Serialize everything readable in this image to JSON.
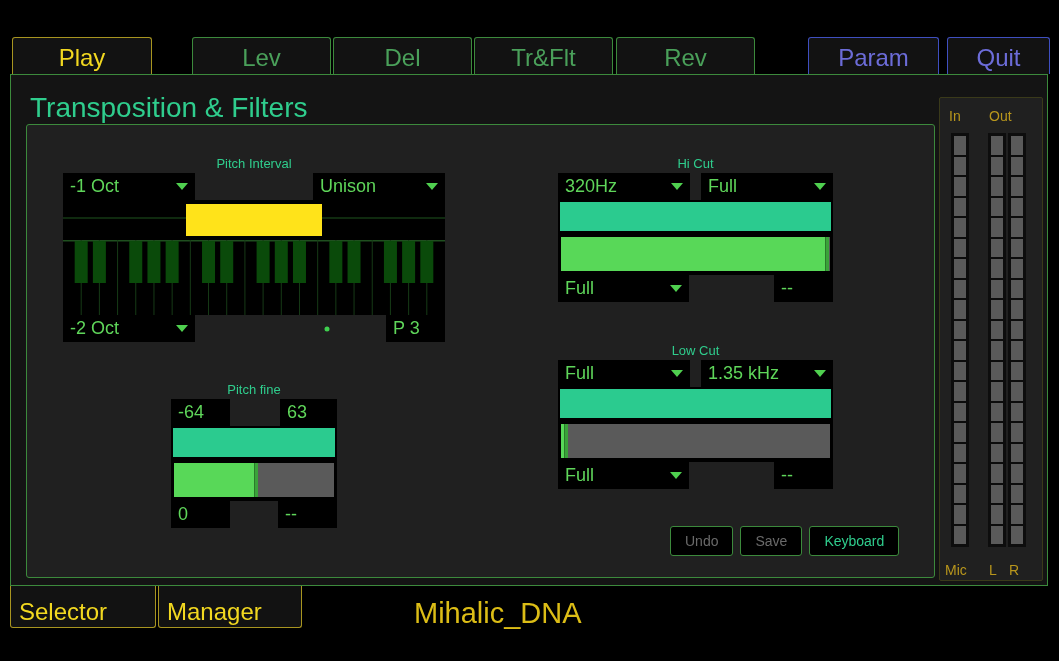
{
  "tabs": [
    {
      "label": "Play",
      "kind": "mode"
    },
    {
      "label": "Lev",
      "kind": "page"
    },
    {
      "label": "Del",
      "kind": "page"
    },
    {
      "label": "Tr&Flt",
      "kind": "page"
    },
    {
      "label": "Rev",
      "kind": "page"
    },
    {
      "label": "Param",
      "kind": "system"
    },
    {
      "label": "Quit",
      "kind": "system"
    }
  ],
  "panel_title": "Transposition & Filters",
  "pitch_interval": {
    "label": "Pitch Interval",
    "top_left": {
      "kind": "dropdown",
      "value": "-1 Oct"
    },
    "top_right": {
      "kind": "dropdown",
      "value": "Unison"
    },
    "range": {
      "start": {
        "level": 0.33
      },
      "end": {
        "level": 0.67
      }
    },
    "bottom_left": {
      "kind": "dropdown",
      "value": "-2 Oct"
    },
    "bottom_right": {
      "kind": "readout",
      "value": "P 3"
    }
  },
  "pitch_fine": {
    "label": "Pitch fine",
    "top_left": {
      "kind": "readout",
      "value": "-64"
    },
    "top_right": {
      "kind": "readout",
      "value": "63"
    },
    "level": 0.5,
    "bottom_left": {
      "kind": "readout",
      "value": "0"
    },
    "bottom_right": {
      "kind": "readout",
      "value": "--"
    }
  },
  "filters": [
    {
      "label": "Hi Cut",
      "top_left": {
        "kind": "dropdown",
        "value": "320Hz"
      },
      "top_right": {
        "kind": "dropdown",
        "value": "Full"
      },
      "level": 0.98,
      "bottom_left": {
        "kind": "dropdown",
        "value": "Full"
      },
      "bottom_right": {
        "kind": "readout",
        "value": "--"
      }
    },
    {
      "label": "Low Cut",
      "top_left": {
        "kind": "dropdown",
        "value": "Full"
      },
      "top_right": {
        "kind": "dropdown",
        "value": "1.35 kHz"
      },
      "level": 0.01,
      "bottom_left": {
        "kind": "dropdown",
        "value": "Full"
      },
      "bottom_right": {
        "kind": "readout",
        "value": "--"
      }
    }
  ],
  "buttons": [
    {
      "label": "Undo",
      "disabled": true
    },
    {
      "label": "Save",
      "disabled": true
    },
    {
      "label": "Keyboard",
      "disabled": false
    }
  ],
  "meters": {
    "in_label": "In",
    "out_label": "Out",
    "channels": [
      {
        "label": "Mic",
        "level": 0
      },
      {
        "label": "L",
        "level": 0
      },
      {
        "label": "R",
        "level": 0
      }
    ]
  },
  "bottom_tabs": [
    {
      "label": "Selector"
    },
    {
      "label": "Manager"
    }
  ],
  "preset_name": "Mihalic_DNA"
}
